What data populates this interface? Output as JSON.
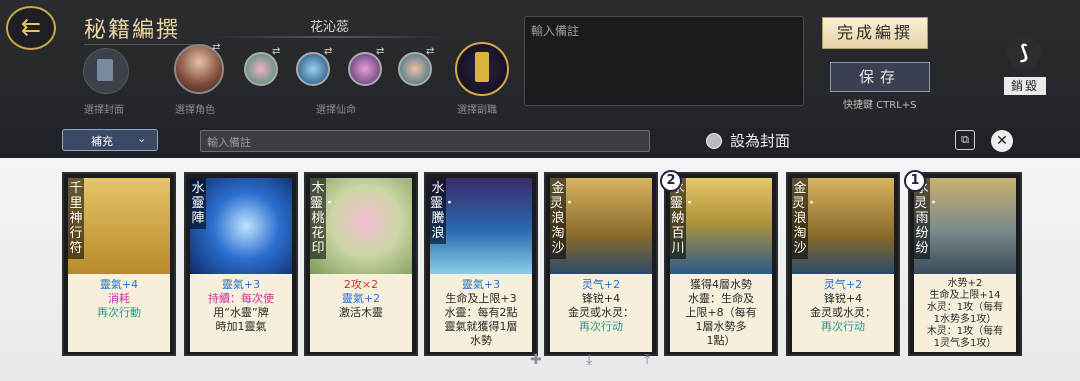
{
  "header": {
    "back_icon": "back-arrow-icon",
    "title": "秘籍編撰",
    "character_name": "花沁蕊",
    "labels": {
      "cover": "選擇封面",
      "role": "選擇角色",
      "fairy": "選擇仙命",
      "sub": "選擇副職"
    },
    "notes_placeholder": "輸入備註",
    "finish_label": "完成編撰",
    "save_label": "保存",
    "shortcut": "快捷鍵 CTRL+S",
    "destroy_label": "銷毀",
    "swap_symbol": "⇄"
  },
  "toolbar": {
    "dropdown_value": "補充",
    "dropdown_chevron": "⌄",
    "notes_placeholder": "輸入備註",
    "cover_radio_label": "設為封面",
    "copy_symbol": "⧉",
    "close_symbol": "✕"
  },
  "cards": [
    {
      "name": "千里神行符",
      "cost": "",
      "desc": [
        "靈氣+4",
        "消耗",
        "再次行動"
      ]
    },
    {
      "name": "水靈陣",
      "cost": "",
      "desc": [
        "靈氣+3",
        "持續：每次使",
        "用“水靈”牌",
        "時加1靈氣"
      ]
    },
    {
      "name": "木靈・桃花印",
      "cost": "",
      "desc": [
        "2攻×2",
        "靈氣+2",
        "激活木靈"
      ]
    },
    {
      "name": "水靈・騰浪",
      "cost": "",
      "desc": [
        "靈氣+3",
        "生命及上限+3",
        "水靈：每有2點",
        "靈氣就獲得1層",
        "水勢"
      ]
    },
    {
      "name": "金灵・浪淘沙",
      "cost": "",
      "desc": [
        "灵气+2",
        "锋锐+4",
        "金灵或水灵：",
        "再次行动"
      ]
    },
    {
      "name": "水靈・納百川",
      "cost": "2",
      "desc": [
        "獲得4層水勢",
        "水靈：生命及",
        "上限+8（每有",
        "1層水勢多",
        "1點）"
      ]
    },
    {
      "name": "金灵・浪淘沙",
      "cost": "",
      "desc": [
        "灵气+2",
        "锋锐+4",
        "金灵或水灵：",
        "再次行动"
      ]
    },
    {
      "name": "水灵・雨纷纷",
      "cost": "1",
      "desc": [
        "水势+2",
        "生命及上限+14",
        "水灵：1攻（每有",
        "1水势多1攻）",
        "木灵：1攻（每有",
        "1灵气多1攻）"
      ]
    }
  ],
  "footer": {
    "add_icon": "✚",
    "import_icon": "⤓",
    "export_icon": "⤒"
  }
}
